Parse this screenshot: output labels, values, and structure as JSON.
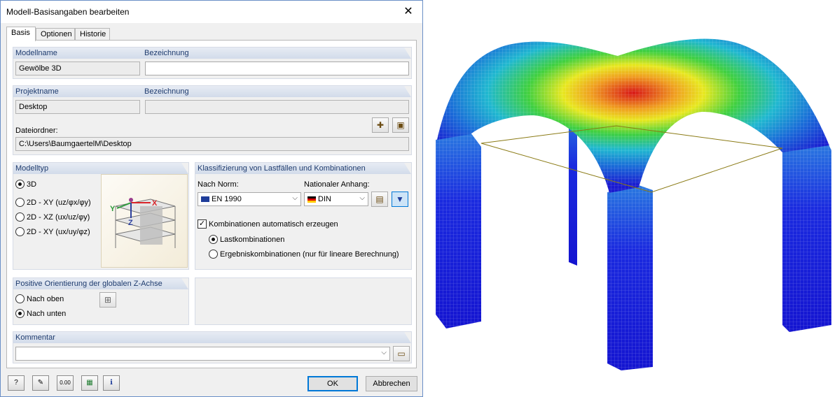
{
  "window": {
    "title": "Modell-Basisangaben bearbeiten",
    "close_glyph": "✕"
  },
  "tabs": [
    "Basis",
    "Optionen",
    "Historie"
  ],
  "model": {
    "name_label": "Modellname",
    "name_value": "Gewölbe 3D",
    "desc_label": "Bezeichnung",
    "desc_value": ""
  },
  "project": {
    "name_label": "Projektname",
    "name_value": "Desktop",
    "desc_label": "Bezeichnung",
    "desc_value": "",
    "folder_label": "Dateiordner:",
    "folder_value": "C:\\Users\\BaumgaertelM\\Desktop"
  },
  "modeltype": {
    "header": "Modelltyp",
    "options": [
      "3D",
      "2D - XY (uz/φx/φy)",
      "2D - XZ (ux/uz/φy)",
      "2D - XY (ux/uy/φz)"
    ],
    "selected": 0
  },
  "classification": {
    "header": "Klassifizierung von Lastfällen und Kombinationen",
    "norm_label": "Nach Norm:",
    "norm_value": "EN 1990",
    "annex_label": "Nationaler Anhang:",
    "annex_value": "DIN",
    "auto_combo_label": "Kombinationen automatisch erzeugen",
    "auto_combo_checked": true,
    "combo_options": [
      "Lastkombinationen",
      "Ergebniskombinationen (nur für lineare Berechnung)"
    ],
    "combo_selected": 0
  },
  "orientation": {
    "header": "Positive Orientierung der globalen Z-Achse",
    "options": [
      "Nach oben",
      "Nach unten"
    ],
    "selected": 1
  },
  "comment": {
    "header": "Kommentar",
    "value": ""
  },
  "footer": {
    "ok": "OK",
    "cancel": "Abbrechen",
    "calc_icon_text": "0.00"
  },
  "axis_labels": {
    "x": "X",
    "y": "Y",
    "z": "Z"
  },
  "icons": {
    "help": "help-icon",
    "edit": "edit-icon",
    "units": "units-icon",
    "excel": "excel-export-icon",
    "info": "info-icon"
  }
}
